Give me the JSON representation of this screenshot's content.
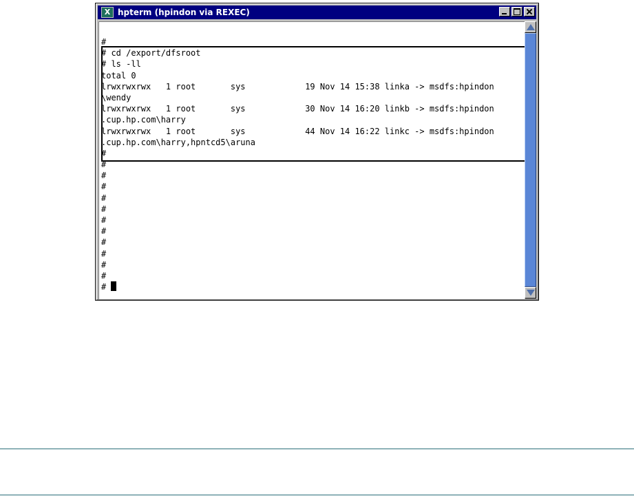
{
  "window": {
    "title": "hpterm (hpindon via REXEC)",
    "icon": "x-terminal-icon",
    "buttons": {
      "minimize": "minimize-icon",
      "maximize": "maximize-icon",
      "close": "close-icon"
    }
  },
  "terminal": {
    "lines": [
      "",
      "#",
      "# cd /export/dfsroot",
      "# ls -ll",
      "total 0",
      "lrwxrwxrwx   1 root       sys            19 Nov 14 15:38 linka -> msdfs:hpindon",
      "\\wendy",
      "lrwxrwxrwx   1 root       sys            30 Nov 14 16:20 linkb -> msdfs:hpindon",
      ".cup.hp.com\\harry",
      "lrwxrwxrwx   1 root       sys            44 Nov 14 16:22 linkc -> msdfs:hpindon",
      ".cup.hp.com\\harry,hpntcd5\\aruna",
      "#",
      "#",
      "#",
      "#",
      "#",
      "#",
      "#",
      "#",
      "#",
      "#",
      "#",
      "#",
      "# "
    ]
  },
  "scrollbar": {
    "thumb_fraction": 1.0
  },
  "colors": {
    "titlebar": "#000080",
    "scroll_thumb": "#5a86d6",
    "rule": "#2c6f7a"
  }
}
